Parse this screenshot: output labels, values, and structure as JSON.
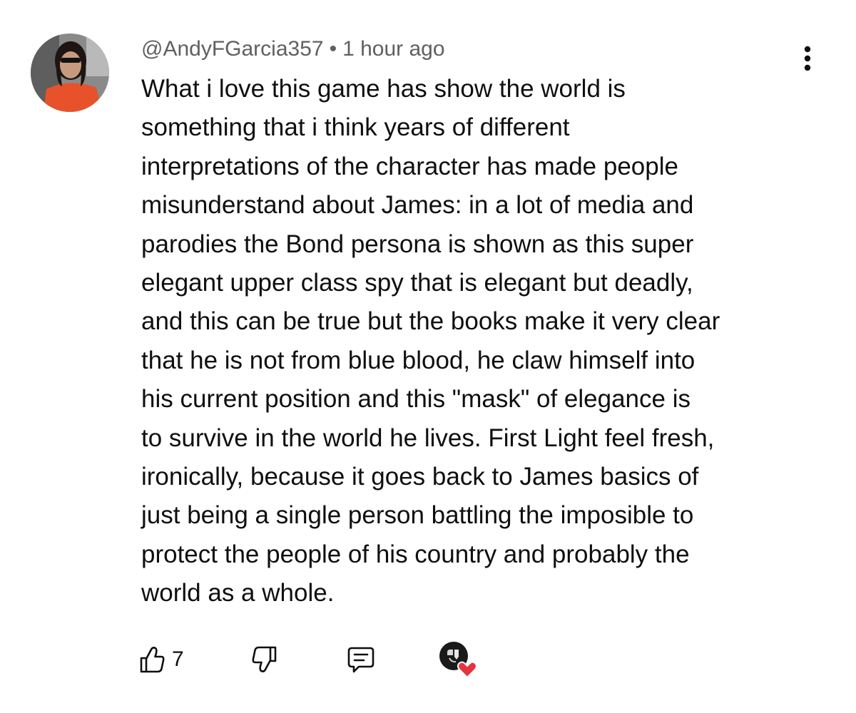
{
  "comment": {
    "author": "@AndyFGarcia357",
    "separator": "•",
    "timestamp": "1 hour ago",
    "text": "What i love this game has show the world is\nsomething that i think years of different\ninterpretations of the character has made people\nmisunderstand about James: in a lot of media and\nparodies the Bond persona is shown as this super\nelegant upper class spy that is elegant but deadly,\nand this can be true but the books make it very clear\nthat he is not from blue blood, he claw himself into\nhis current position and this \"mask\" of elegance is\nto survive in the world he lives. First Light feel fresh,\nironically, because it goes back to James basics of\njust being a single person battling the imposible to\nprotect the people of his country and probably the\nworld as a whole.",
    "like_count": "7"
  },
  "icons": {
    "menu": "more-vertical-icon",
    "like": "thumbs-up-icon",
    "dislike": "thumbs-down-icon",
    "reply": "reply-comment-icon",
    "creator_heart": "creator-heart-icon"
  },
  "colors": {
    "text": "#0f0f0f",
    "meta": "#606060",
    "heart": "#e8333f"
  }
}
